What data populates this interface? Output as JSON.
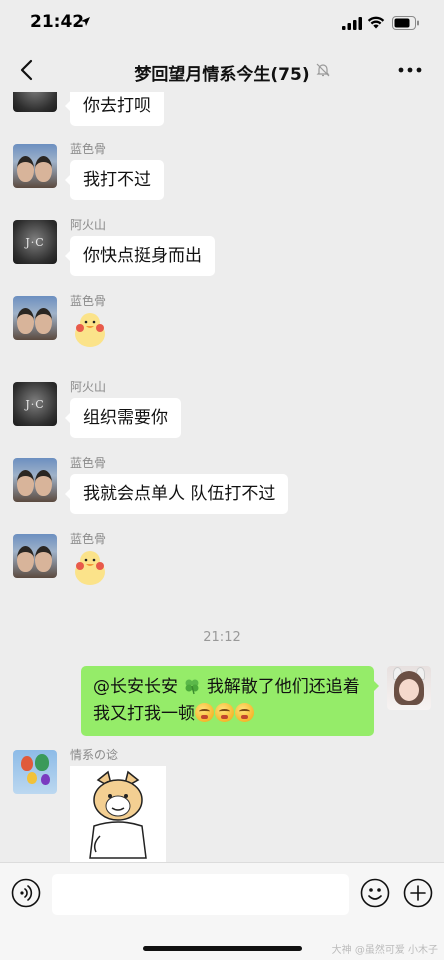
{
  "status_bar": {
    "time": "21:42"
  },
  "nav": {
    "title": "梦回望月情系今生(75)"
  },
  "messages": [
    {
      "text": "你去打呗"
    },
    {
      "sender": "蓝色骨",
      "text": "我打不过"
    },
    {
      "sender": "阿火山",
      "avatar_label": "J·C",
      "text": "你快点挺身而出"
    },
    {
      "sender": "蓝色骨",
      "sticker": "duck-sticker"
    },
    {
      "sender": "阿火山",
      "avatar_label": "J·C",
      "text": "组织需要你"
    },
    {
      "sender": "蓝色骨",
      "text": "我就会点单人 队伍打不过"
    },
    {
      "sender": "蓝色骨",
      "sticker": "duck-sticker"
    }
  ],
  "timestamp": "21:12",
  "outgoing": {
    "mention": "@长安长安",
    "text": "我解散了他们还追着我又打我一顿"
  },
  "last_message": {
    "sender": "情系の谂",
    "sticker": "doge-sticker"
  },
  "input_bar": {
    "placeholder": ""
  },
  "watermark": "大神 @虽然可爱 小木子",
  "colors": {
    "background": "#ededed",
    "self_bubble": "#95ec69",
    "other_bubble": "#ffffff",
    "sender_name": "#8a8a8a"
  }
}
